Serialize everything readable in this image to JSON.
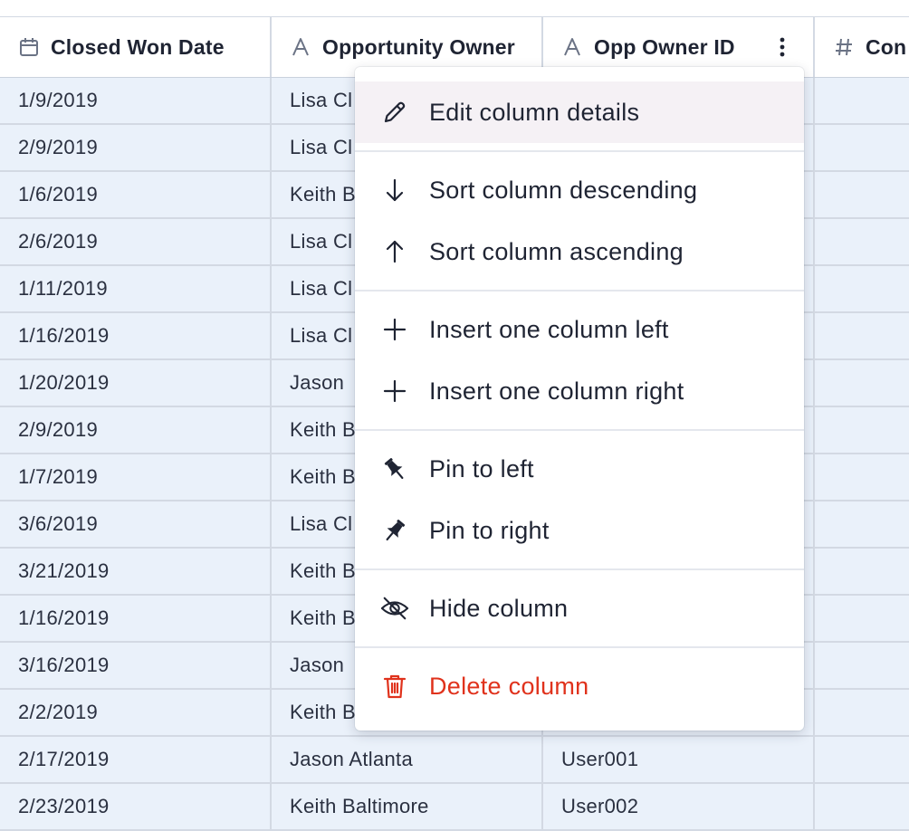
{
  "columns": [
    {
      "label": "Closed Won Date",
      "icon": "calendar-icon"
    },
    {
      "label": "Opportunity Owner",
      "icon": "text-type-icon"
    },
    {
      "label": "Opp Owner ID",
      "icon": "text-type-icon"
    },
    {
      "label": "Con",
      "icon": "number-type-icon"
    }
  ],
  "rows": [
    {
      "date": "1/9/2019",
      "owner": "Lisa Cl",
      "owner_id": ""
    },
    {
      "date": "2/9/2019",
      "owner": "Lisa Cl",
      "owner_id": ""
    },
    {
      "date": "1/6/2019",
      "owner": "Keith B",
      "owner_id": ""
    },
    {
      "date": "2/6/2019",
      "owner": "Lisa Cl",
      "owner_id": ""
    },
    {
      "date": "1/11/2019",
      "owner": "Lisa Cl",
      "owner_id": ""
    },
    {
      "date": "1/16/2019",
      "owner": "Lisa Cl",
      "owner_id": ""
    },
    {
      "date": "1/20/2019",
      "owner": "Jason",
      "owner_id": ""
    },
    {
      "date": "2/9/2019",
      "owner": "Keith B",
      "owner_id": ""
    },
    {
      "date": "1/7/2019",
      "owner": "Keith B",
      "owner_id": ""
    },
    {
      "date": "3/6/2019",
      "owner": "Lisa Cl",
      "owner_id": ""
    },
    {
      "date": "3/21/2019",
      "owner": "Keith B",
      "owner_id": ""
    },
    {
      "date": "1/16/2019",
      "owner": "Keith B",
      "owner_id": ""
    },
    {
      "date": "3/16/2019",
      "owner": "Jason",
      "owner_id": ""
    },
    {
      "date": "2/2/2019",
      "owner": "Keith B",
      "owner_id": ""
    },
    {
      "date": "2/17/2019",
      "owner": "Jason Atlanta",
      "owner_id": "User001"
    },
    {
      "date": "2/23/2019",
      "owner": "Keith Baltimore",
      "owner_id": "User002"
    }
  ],
  "menu": {
    "edit": "Edit column details",
    "sort_desc": "Sort column descending",
    "sort_asc": "Sort column ascending",
    "insert_left": "Insert one column left",
    "insert_right": "Insert one column right",
    "pin_left": "Pin to left",
    "pin_right": "Pin to right",
    "hide": "Hide column",
    "delete": "Delete column"
  },
  "colors": {
    "cell_bg": "#eaf1fa",
    "grid_line": "#d3d9e3",
    "danger": "#e0321c",
    "hover_bg": "#f5f1f5"
  }
}
